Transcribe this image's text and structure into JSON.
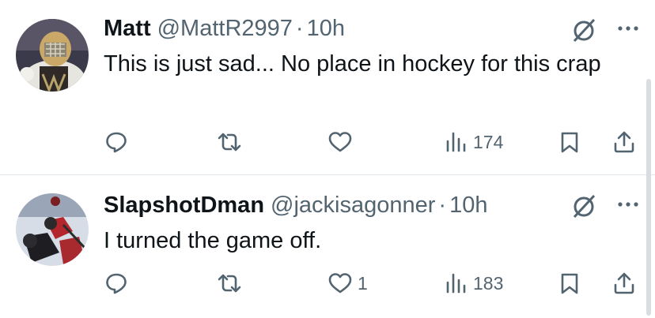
{
  "tweets": [
    {
      "name": "Matt",
      "handle": "@MattR2997",
      "separator": "·",
      "time": "10h",
      "text": "This is just sad... No place in hockey for this crap",
      "stats": {
        "replies": "",
        "retweets": "",
        "likes": "",
        "views": "174"
      },
      "avatar_icon": "goalie-avatar"
    },
    {
      "name": "SlapshotDman",
      "handle": "@jackisagonner",
      "separator": "·",
      "time": "10h",
      "text": "I turned the game off.",
      "stats": {
        "replies": "",
        "retweets": "",
        "likes": "1",
        "views": "183"
      },
      "avatar_icon": "hockey-players-avatar"
    }
  ],
  "icons": [
    "reply-icon",
    "retweet-icon",
    "like-icon",
    "views-icon",
    "bookmark-icon",
    "share-icon",
    "grok-icon",
    "more-icon"
  ],
  "colors": {
    "text": "#0f1419",
    "secondary": "#536471",
    "divider": "#e1e8ed"
  }
}
